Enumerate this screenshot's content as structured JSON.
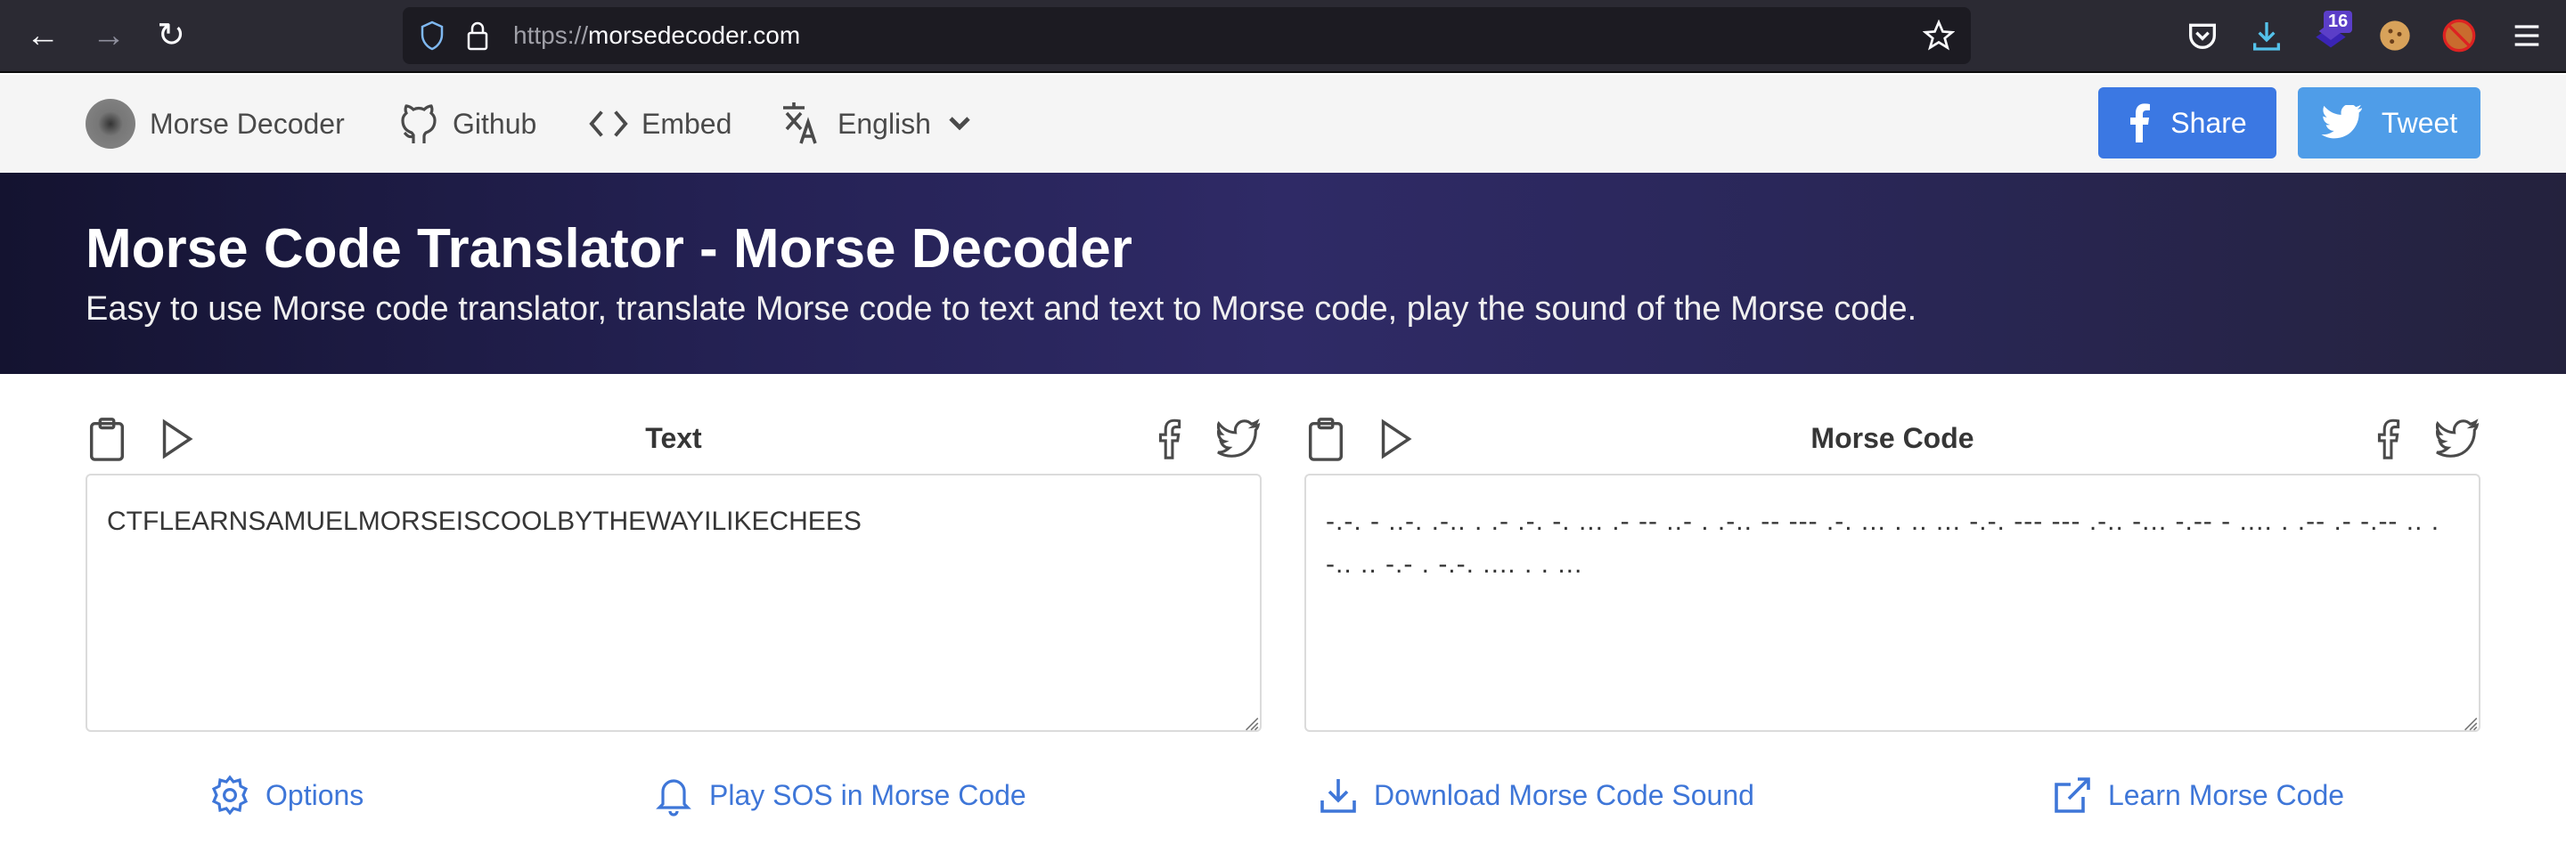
{
  "browser": {
    "url_protocol": "https://",
    "url_domain": "morsedecoder.com",
    "extension_badge": "16"
  },
  "nav": {
    "brand": "Morse Decoder",
    "github": "Github",
    "embed": "Embed",
    "language": "English",
    "share": "Share",
    "tweet": "Tweet"
  },
  "hero": {
    "title": "Morse Code Translator - Morse Decoder",
    "subtitle": "Easy to use Morse code translator, translate Morse code to text and text to Morse code, play the sound of the Morse code."
  },
  "text_panel": {
    "title": "Text",
    "value": "CTFLEARNSAMUELMORSEISCOOLBYTHEWAYILIKECHEES"
  },
  "morse_panel": {
    "title": "Morse Code",
    "value": "-.-. - ..-. .-.. . .- .-. -. ... .- -- ..- . .-.. -- --- .-. ... . .. ... -.-. --- --- .-.. -... -.-- - .... . .-- .- -.-- .. .-.. .. -.- . -.-. .... . . ..."
  },
  "actions": {
    "options": "Options",
    "play_sos": "Play SOS in Morse Code",
    "download": "Download Morse Code Sound",
    "learn": "Learn Morse Code"
  },
  "colors": {
    "facebook": "#3b78e3",
    "twitter": "#4f9de8",
    "link": "#3e76d8"
  }
}
